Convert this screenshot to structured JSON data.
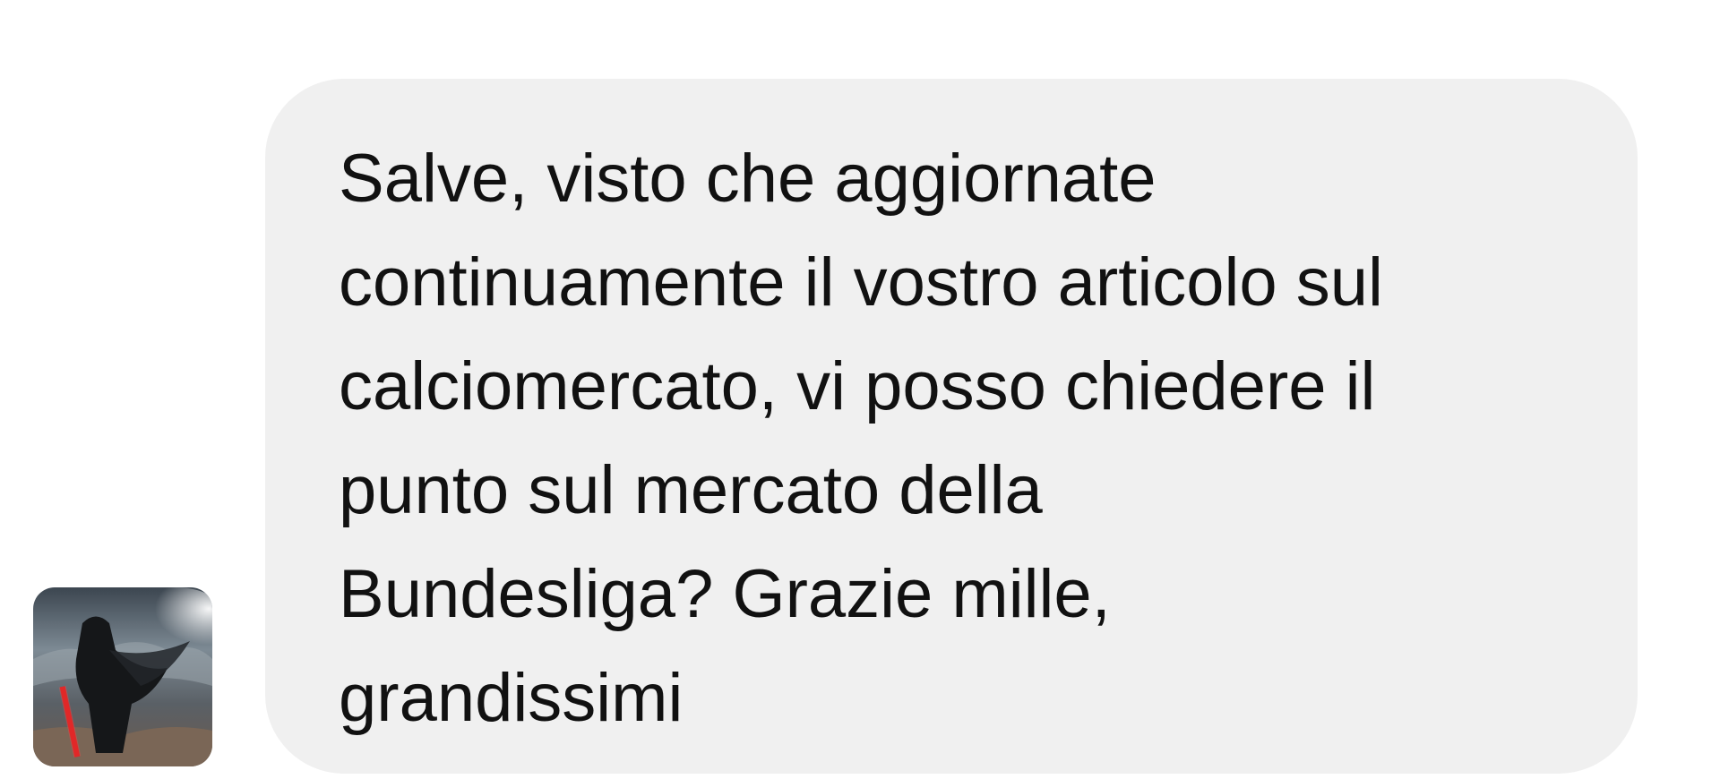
{
  "message": {
    "text": "Salve, visto che aggiornate\ncontinuamente il vostro articolo sul\ncalciomercato, vi posso chiedere il\npunto sul mercato della\nBundesliga? Grazie mille,\ngrandissimi"
  },
  "colors": {
    "bubble_background": "#f0f0f0",
    "text": "#111111",
    "page_background": "#ffffff"
  },
  "avatar": {
    "icon": "user-avatar-icon"
  }
}
